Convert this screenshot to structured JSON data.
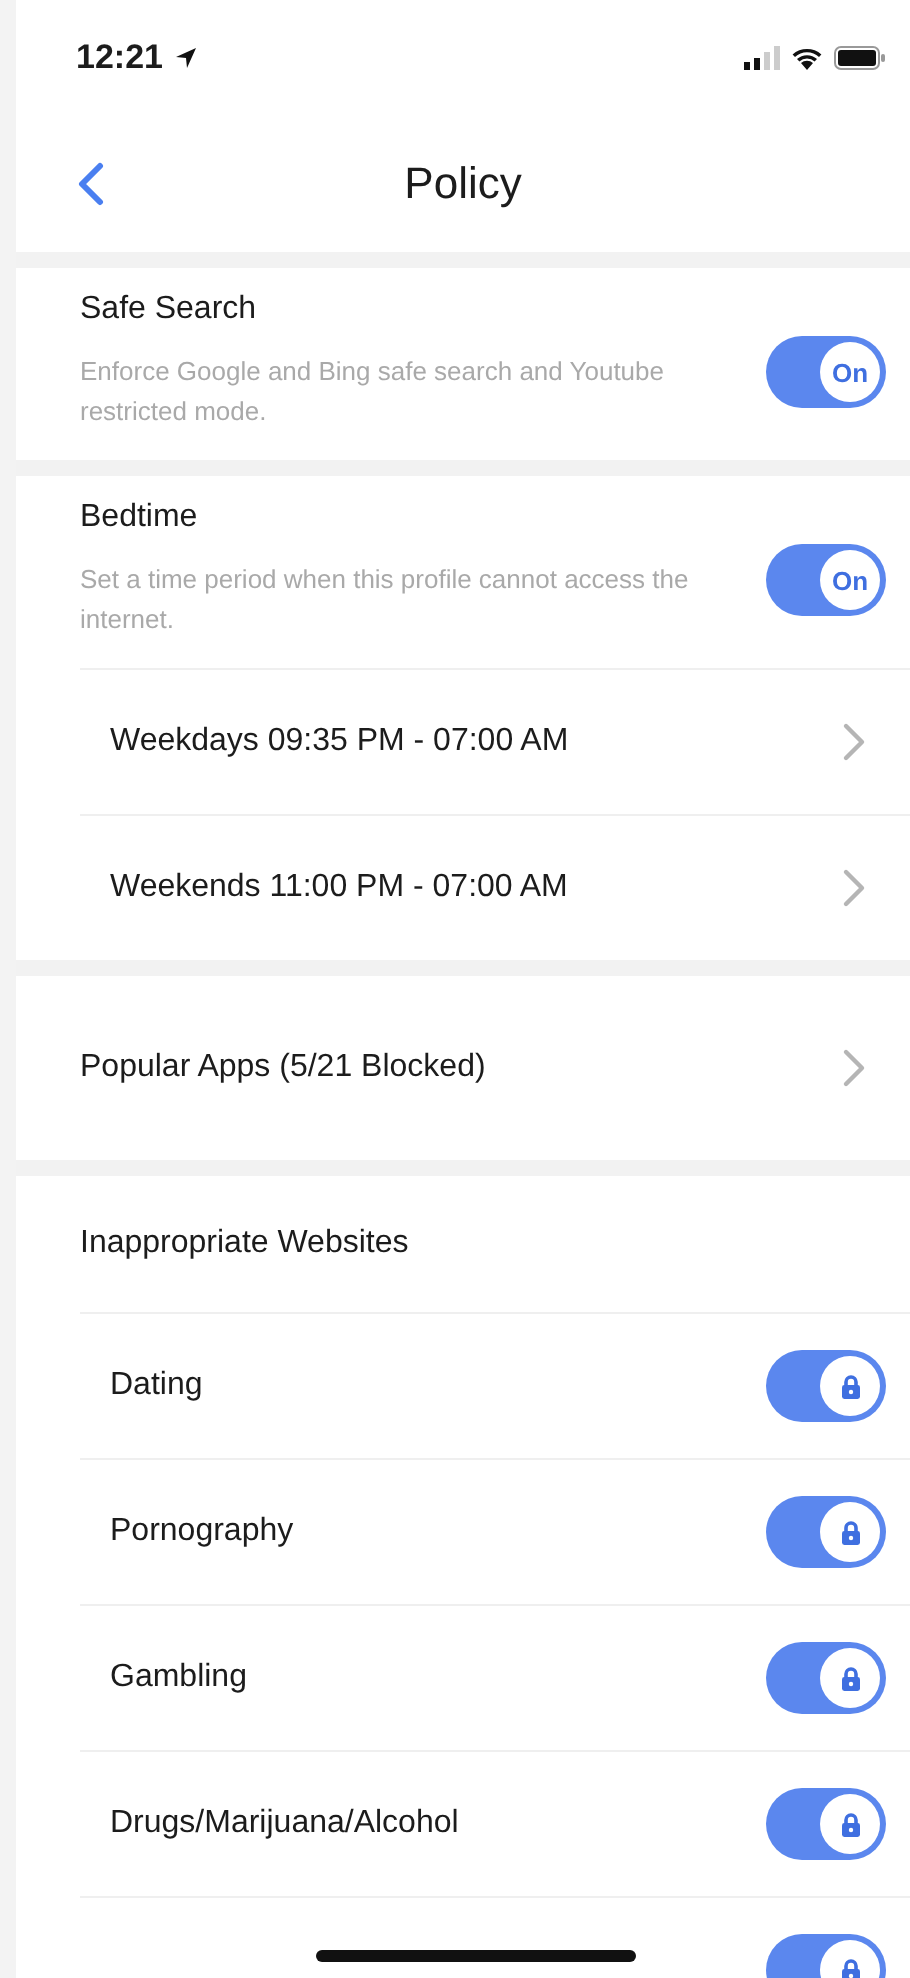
{
  "status_bar": {
    "time": "12:21"
  },
  "nav": {
    "title": "Policy"
  },
  "sections": [
    {
      "kind": "switch",
      "title": "Safe Search",
      "description": "Enforce Google and Bing safe search and Youtube restricted mode.",
      "toggle": {
        "on": true,
        "kind": "text",
        "label": "On"
      }
    },
    {
      "kind": "switch",
      "title": "Bedtime",
      "description": "Set a time period when this profile cannot access the internet.",
      "toggle": {
        "on": true,
        "kind": "text",
        "label": "On"
      },
      "rows": [
        {
          "label": "Weekdays 09:35 PM - 07:00 AM"
        },
        {
          "label": "Weekends 11:00 PM - 07:00 AM"
        }
      ]
    },
    {
      "kind": "link",
      "title": "Popular Apps (5/21 Blocked)"
    },
    {
      "kind": "list",
      "title": "Inappropriate Websites",
      "items": [
        {
          "label": "Dating",
          "toggle": {
            "on": true,
            "kind": "lock"
          }
        },
        {
          "label": "Pornography",
          "toggle": {
            "on": true,
            "kind": "lock"
          }
        },
        {
          "label": "Gambling",
          "toggle": {
            "on": true,
            "kind": "lock"
          }
        },
        {
          "label": "Drugs/Marijuana/Alcohol",
          "toggle": {
            "on": true,
            "kind": "lock"
          }
        },
        {
          "toggle": {
            "on": true,
            "kind": "lock"
          }
        }
      ]
    }
  ]
}
